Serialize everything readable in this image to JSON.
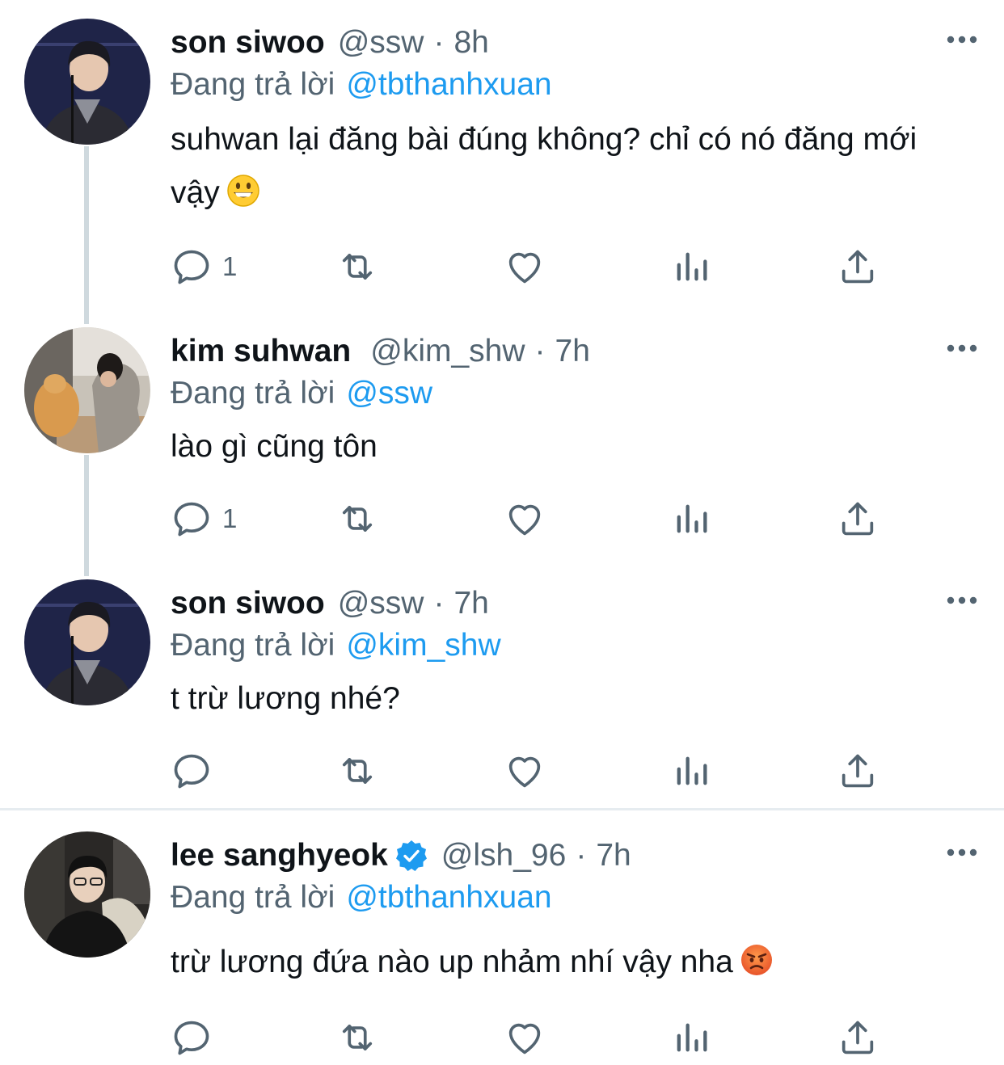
{
  "colors": {
    "link": "#1d9bf0",
    "muted": "#536471",
    "text": "#0f1419",
    "thread_line": "#cfd9de",
    "verified": "#1d9bf0"
  },
  "tweets": [
    {
      "name": "son siwoo",
      "handle": "@ssw",
      "separator": "·",
      "time": "8h",
      "replying_label": "Đang trả lời",
      "replying_to": "@tbthanhxuan",
      "text": "suhwan lại đăng bài đúng không? chỉ có nó đăng mới vậy",
      "emoji": "grinning-face",
      "reply_count": "1",
      "verified": false
    },
    {
      "name": "kim suhwan",
      "handle": "@kim_shw",
      "separator": "·",
      "time": "7h",
      "replying_label": "Đang trả lời",
      "replying_to": "@ssw",
      "text": "lào gì cũng tôn",
      "reply_count": "1",
      "verified": false
    },
    {
      "name": "son siwoo",
      "handle": "@ssw",
      "separator": "·",
      "time": "7h",
      "replying_label": "Đang trả lời",
      "replying_to": "@kim_shw",
      "text": "t trừ lương nhé?",
      "reply_count": "",
      "verified": false
    },
    {
      "name": "lee sanghyeok",
      "handle": "@lsh_96",
      "separator": "·",
      "time": "7h",
      "replying_label": "Đang trả lời",
      "replying_to": "@tbthanhxuan",
      "text": "trừ lương đứa nào up nhảm nhí vậy nha",
      "emoji": "angry-face",
      "reply_count": "",
      "verified": true
    }
  ],
  "icons": {
    "reply": "reply-icon",
    "retweet": "retweet-icon",
    "like": "heart-icon",
    "analytics": "analytics-icon",
    "share": "share-icon",
    "more": "more-icon"
  }
}
